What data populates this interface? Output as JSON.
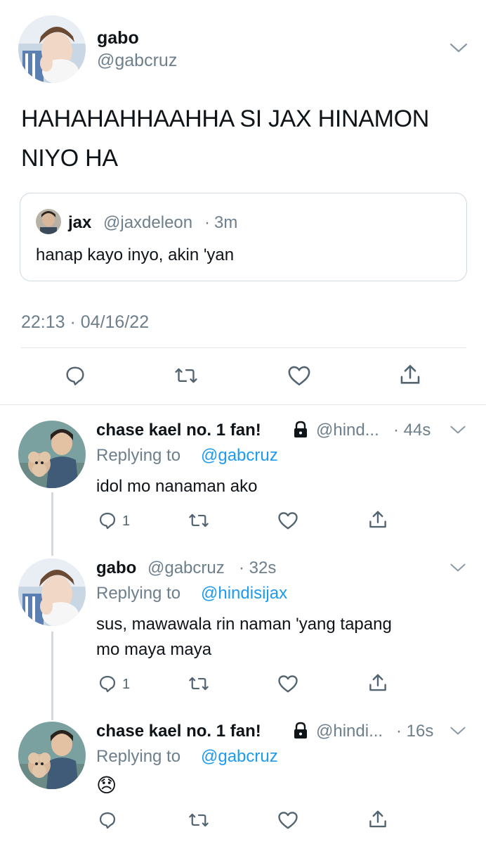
{
  "main_tweet": {
    "display_name": "gabo",
    "handle": "@gabcruz",
    "text_line1": "HAHAHAHHAAHHA SI JAX HINAMON",
    "text_line2": "NIYO HA",
    "timestamp": "22:13 · 04/16/22",
    "quoted": {
      "display_name": "jax",
      "handle": "@jaxdeleon",
      "dot": "·",
      "time": "3m",
      "text": "hanap kayo inyo, akin 'yan"
    }
  },
  "replies": [
    {
      "display_name": "chase kael no. 1 fan!",
      "handle": "@hind...",
      "time": "· 44s",
      "replying_prefix": "Replying to",
      "replying_to": "@gabcruz",
      "text_line1": "idol mo nanaman ako",
      "text_line2": "",
      "reply_count": "1"
    },
    {
      "display_name": "gabo",
      "handle": "@gabcruz",
      "time": "· 32s",
      "replying_prefix": "Replying to",
      "replying_to": "@hindisijax",
      "text_line1": "sus, mawawala rin naman 'yang tapang",
      "text_line2": "mo maya maya",
      "reply_count": "1"
    },
    {
      "display_name": "chase kael no. 1 fan!",
      "handle": "@hindi...",
      "time": "· 16s",
      "replying_prefix": "Replying to",
      "replying_to": "@gabcruz",
      "text_line1": "😞",
      "text_line2": "",
      "reply_count": ""
    }
  ],
  "icons": {
    "reply": "speech-bubble-icon",
    "retweet": "retweet-arrows-icon",
    "like": "heart-icon",
    "share": "share-upload-icon",
    "more": "chevron-down-icon",
    "protected": "lock-icon"
  },
  "colors": {
    "link": "#1d9bf0",
    "muted": "#6e7f8c",
    "text": "#0f1419"
  }
}
